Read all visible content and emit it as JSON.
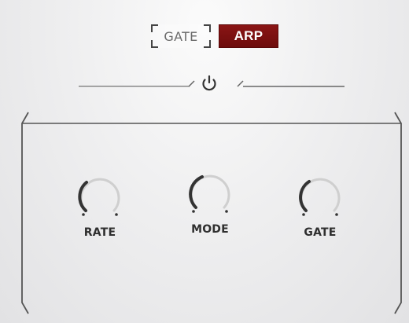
{
  "mode_tabs": [
    {
      "label": "GATE",
      "active": false
    },
    {
      "label": "ARP",
      "active": true
    }
  ],
  "power": {
    "icon": "power-icon",
    "on": true
  },
  "knobs": [
    {
      "label": "RATE",
      "value": 0.12
    },
    {
      "label": "MODE",
      "value": 0.18
    },
    {
      "label": "GATE",
      "value": 0.14
    }
  ],
  "colors": {
    "active_tab": "#7d1010",
    "frame_line": "#555555",
    "knob_track": "#c8c8c8",
    "knob_indicator": "#333333"
  }
}
